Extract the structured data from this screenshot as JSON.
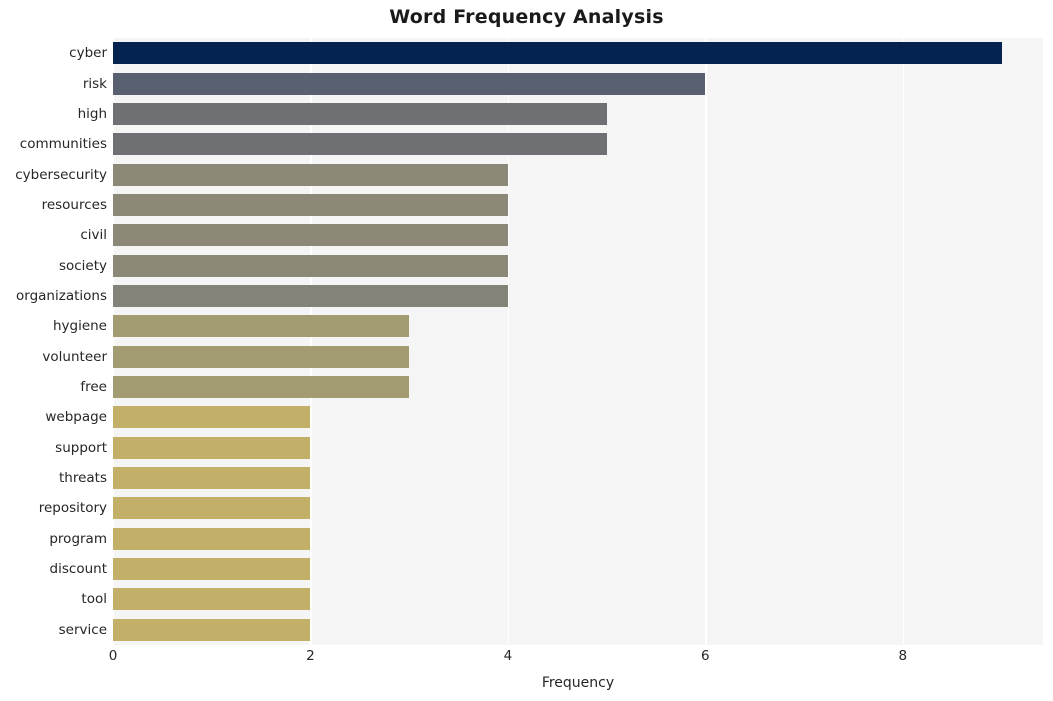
{
  "chart_data": {
    "type": "bar",
    "orientation": "horizontal",
    "title": "Word Frequency Analysis",
    "xlabel": "Frequency",
    "ylabel": "",
    "categories": [
      "cyber",
      "risk",
      "high",
      "communities",
      "cybersecurity",
      "resources",
      "civil",
      "society",
      "organizations",
      "hygiene",
      "volunteer",
      "free",
      "webpage",
      "support",
      "threats",
      "repository",
      "program",
      "discount",
      "tool",
      "service"
    ],
    "values": [
      9,
      6,
      5,
      5,
      4,
      4,
      4,
      4,
      4,
      3,
      3,
      3,
      2,
      2,
      2,
      2,
      2,
      2,
      2,
      2
    ],
    "bar_colors": [
      "#04244f",
      "#59606f",
      "#6e7073",
      "#6e7073",
      "#8b8878",
      "#8b8878",
      "#8b8878",
      "#8b8878",
      "#83837a",
      "#a39c72",
      "#a39c72",
      "#a39c72",
      "#c3b068",
      "#c3b068",
      "#c3b068",
      "#c3b068",
      "#c3b068",
      "#c3b068",
      "#c3b068",
      "#c3b068"
    ],
    "xlim": [
      0,
      9.42
    ],
    "xticks": [
      0,
      2,
      4,
      6,
      8
    ],
    "xtick_labels": [
      "0",
      "2",
      "4",
      "6",
      "8"
    ],
    "grid": "vertical-white",
    "plot_background": "#f5f5f5",
    "figure_background": "#ffffff",
    "legend": null
  }
}
